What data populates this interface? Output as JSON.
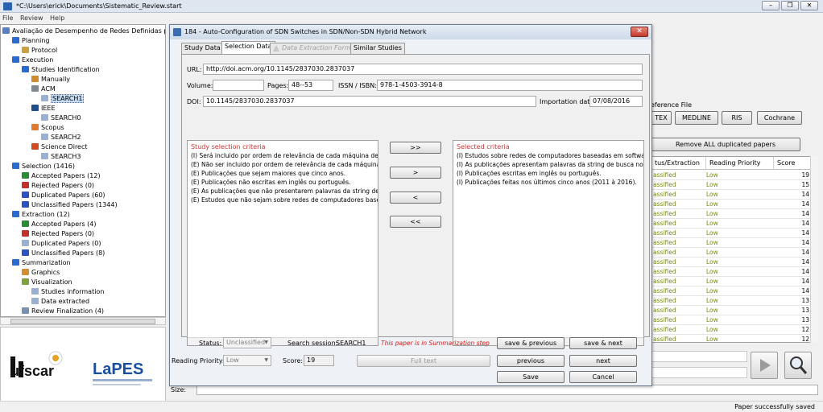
{
  "window": {
    "title": "*C:\\Users\\erick\\Documents\\Sistematic_Review.start"
  },
  "menu": [
    "File",
    "Review",
    "Help"
  ],
  "tree": [
    {
      "label": "Avaliação de Desempenho de Redes Definidas por Soft",
      "indent": 0,
      "color": "#5a7fc0"
    },
    {
      "label": "Planning",
      "indent": 1,
      "color": "#2a6bd0"
    },
    {
      "label": "Protocol",
      "indent": 2,
      "color": "#caa040"
    },
    {
      "label": "Execution",
      "indent": 1,
      "color": "#2a6bd0"
    },
    {
      "label": "Studies Identification",
      "indent": 2,
      "color": "#2a6bd0"
    },
    {
      "label": "Manually",
      "indent": 3,
      "color": "#d08a30"
    },
    {
      "label": "ACM",
      "indent": 3,
      "color": "#808890"
    },
    {
      "label": "SEARCH1",
      "indent": 4,
      "color": "#9ab0d0",
      "selected": true
    },
    {
      "label": "IEEE",
      "indent": 3,
      "color": "#1e4c8c"
    },
    {
      "label": "SEARCH0",
      "indent": 4,
      "color": "#9ab0d0"
    },
    {
      "label": "Scopus",
      "indent": 3,
      "color": "#e07a30"
    },
    {
      "label": "SEARCH2",
      "indent": 4,
      "color": "#9ab0d0"
    },
    {
      "label": "Science Direct",
      "indent": 3,
      "color": "#d04a20"
    },
    {
      "label": "SEARCH3",
      "indent": 4,
      "color": "#9ab0d0"
    },
    {
      "label": "Selection (1416)",
      "indent": 1,
      "color": "#2a6bd0"
    },
    {
      "label": "Accepted Papers (12)",
      "indent": 2,
      "color": "#2a8a3a"
    },
    {
      "label": "Rejected Papers (0)",
      "indent": 2,
      "color": "#c03030"
    },
    {
      "label": "Duplicated Papers (60)",
      "indent": 2,
      "color": "#3050c0"
    },
    {
      "label": "Unclassified Papers (1344)",
      "indent": 2,
      "color": "#3050c0"
    },
    {
      "label": "Extraction (12)",
      "indent": 1,
      "color": "#2a6bd0"
    },
    {
      "label": "Accepted Papers (4)",
      "indent": 2,
      "color": "#2a8a3a"
    },
    {
      "label": "Rejected Papers (0)",
      "indent": 2,
      "color": "#c03030"
    },
    {
      "label": "Duplicated Papers (0)",
      "indent": 2,
      "color": "#9ab0d0"
    },
    {
      "label": "Unclassified Papers (8)",
      "indent": 2,
      "color": "#3050c0"
    },
    {
      "label": "Summarization",
      "indent": 1,
      "color": "#2a6bd0"
    },
    {
      "label": "Graphics",
      "indent": 2,
      "color": "#d09030"
    },
    {
      "label": "Visualization",
      "indent": 2,
      "color": "#80a040"
    },
    {
      "label": "Studies information",
      "indent": 3,
      "color": "#9ab0d0"
    },
    {
      "label": "Data extracted",
      "indent": 3,
      "color": "#9ab0d0"
    },
    {
      "label": "Review Finalization (4)",
      "indent": 2,
      "color": "#7a90b0"
    }
  ],
  "logos": {
    "left": "ufscar",
    "right": "LaPES"
  },
  "background": {
    "reference_label": "eference File",
    "ref_buttons": [
      "TEX",
      "MEDLINE",
      "RIS",
      "Cochrane"
    ],
    "remove_button": "Remove ALL duplicated papers",
    "columns": [
      "tus/Extraction",
      "Reading Priority",
      "Score"
    ],
    "rows": [
      [
        "assified",
        "Low",
        "19"
      ],
      [
        "assified",
        "Low",
        "15"
      ],
      [
        "assified",
        "Low",
        "14"
      ],
      [
        "assified",
        "Low",
        "14"
      ],
      [
        "assified",
        "Low",
        "14"
      ],
      [
        "assified",
        "Low",
        "14"
      ],
      [
        "assified",
        "Low",
        "14"
      ],
      [
        "assified",
        "Low",
        "14"
      ],
      [
        "assified",
        "Low",
        "14"
      ],
      [
        "assified",
        "Low",
        "14"
      ],
      [
        "assified",
        "Low",
        "14"
      ],
      [
        "assified",
        "Low",
        "14"
      ],
      [
        "assified",
        "Low",
        "14"
      ],
      [
        "assified",
        "Low",
        "13"
      ],
      [
        "assified",
        "Low",
        "13"
      ],
      [
        "assified",
        "Low",
        "13"
      ],
      [
        "assified",
        "Low",
        "12"
      ],
      [
        "assified",
        "Low",
        "12"
      ],
      [
        "assified",
        "Low",
        "12"
      ]
    ],
    "status_message": "Paper successfully saved",
    "size_label": "Size:"
  },
  "dialog": {
    "title": "184 - Auto-Configuration of SDN Switches in SDN/Non-SDN Hybrid Network",
    "tabs": [
      "Study Data",
      "Selection Data",
      "Data Extraction Form",
      "Similar Studies"
    ],
    "url_label": "URL:",
    "url": "http://doi.acm.org/10.1145/2837030.2837037",
    "volume_label": "Volume:",
    "volume": "",
    "pages_label": "Pages:",
    "pages": "48--53",
    "issn_label": "ISSN / ISBN:",
    "issn": "978-1-4503-3914-8",
    "doi_label": "DOI:",
    "doi": "10.1145/2837030.2837037",
    "import_label": "Importation date:",
    "import_date": "07/08/2016",
    "study_criteria_title": "Study selection criteria",
    "study_criteria": [
      "(I) Será incluido por ordem de relevância de cada máquina de busc",
      "(E) Não ser incluido por ordem de relevância de cada máquina de b",
      "(E) Publicações que sejam maiores que cinco anos.",
      "(E) Publicações não escritas em inglês ou português.",
      "(E) As publicações que não presentarem palavras da string de bus",
      "(E) Estudos que não sejam sobre redes de computadores baseada"
    ],
    "selected_criteria_title": "Selected criteria",
    "selected_criteria": [
      "(I) Estudos sobre redes de computadores baseadas em software",
      "(I) As publicações apresentam palavras da string de busca no se",
      "(I) Publicações escritas em inglês ou português.",
      "(I) Publicações feitas nos últimos cinco anos (2011 à 2016)."
    ],
    "move_buttons": [
      ">>",
      ">",
      "<",
      "<<"
    ],
    "status_label": "Status:",
    "status_value": "Unclassified",
    "session_label": "Search session:",
    "session_value": "SEARCH1",
    "summarization_note": "This paper is in Summarization step",
    "priority_label": "Reading Priority:",
    "priority_value": "Low",
    "score_label": "Score:",
    "score_value": "19",
    "full_text": "Full text",
    "save_previous": "save & previous",
    "save_next": "save & next",
    "previous": "previous",
    "next": "next",
    "save": "Save",
    "cancel": "Cancel"
  }
}
